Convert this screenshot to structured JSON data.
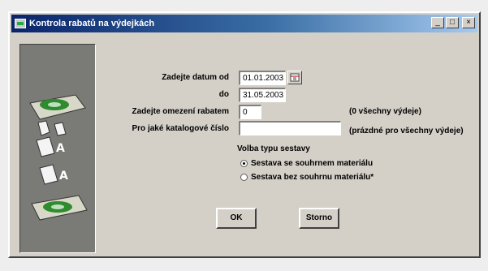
{
  "window": {
    "title": "Kontrola rabatů na výdejkách",
    "btn_min": "_",
    "btn_max": "□",
    "btn_close": "×"
  },
  "form": {
    "date_from_label": "Zadejte datum od",
    "date_from_value": "01.01.2003",
    "date_to_label": "do",
    "date_to_value": "31.05.2003",
    "rabat_label": "Zadejte omezení rabatem",
    "rabat_value": "0",
    "rabat_hint": "(0 všechny výdeje)",
    "catalog_label": "Pro jaké katalogové číslo",
    "catalog_value": "",
    "catalog_hint": "(prázdné pro všechny výdeje)",
    "report_type_title": "Volba typu sestavy",
    "option1": "Sestava se souhrnem materiálu",
    "option2": "Sestava bez souhrnu materiálu*"
  },
  "buttons": {
    "ok": "OK",
    "cancel": "Storno"
  },
  "icons": [
    "app-icon",
    "calendar-icon",
    "cassette-illustration"
  ]
}
